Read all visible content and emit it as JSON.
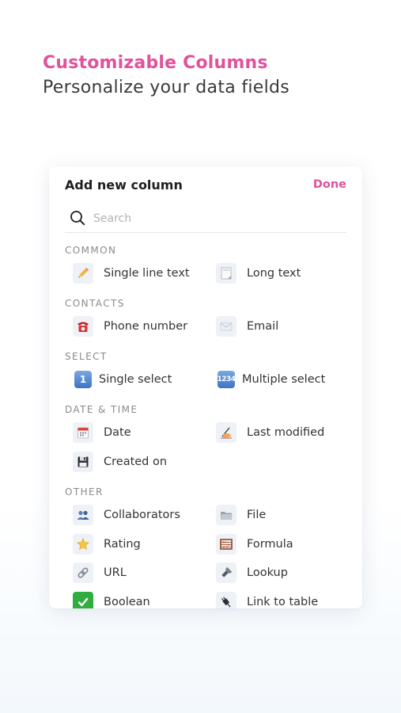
{
  "hero": {
    "title": "Customizable Columns",
    "subtitle": "Personalize your data fields"
  },
  "dialog": {
    "title": "Add new column",
    "done_label": "Done",
    "search": {
      "placeholder": "Search",
      "value": ""
    },
    "sections": {
      "common": {
        "label": "COMMON",
        "items": [
          {
            "label": "Single line text",
            "icon": "pencil-icon"
          },
          {
            "label": "Long text",
            "icon": "page-icon"
          }
        ]
      },
      "contacts": {
        "label": "CONTACTS",
        "items": [
          {
            "label": "Phone number",
            "icon": "telephone-icon"
          },
          {
            "label": "Email",
            "icon": "envelope-icon"
          }
        ]
      },
      "select": {
        "label": "SELECT",
        "items": [
          {
            "label": "Single select",
            "icon": "keycap-one-icon",
            "glyph": "1"
          },
          {
            "label": "Multiple select",
            "icon": "keycap-numbers-icon",
            "glyph": "1234"
          }
        ]
      },
      "date_time": {
        "label": "DATE & TIME",
        "items": [
          {
            "label": "Date",
            "icon": "calendar-icon"
          },
          {
            "label": "Last modified",
            "icon": "writing-hand-icon"
          },
          {
            "label": "Created on",
            "icon": "floppy-disk-icon"
          }
        ]
      },
      "other": {
        "label": "OTHER",
        "items": [
          {
            "label": "Collaborators",
            "icon": "people-icon"
          },
          {
            "label": "File",
            "icon": "folder-icon"
          },
          {
            "label": "Rating",
            "icon": "star-icon"
          },
          {
            "label": "Formula",
            "icon": "abacus-icon"
          },
          {
            "label": "URL",
            "icon": "link-icon"
          },
          {
            "label": "Lookup",
            "icon": "flashlight-icon"
          },
          {
            "label": "Boolean",
            "icon": "check-box-icon"
          },
          {
            "label": "Link to table",
            "icon": "plug-icon"
          }
        ]
      }
    }
  },
  "colors": {
    "accent": "#e0529b",
    "text": "#333333",
    "section": "#8a8a8a"
  }
}
